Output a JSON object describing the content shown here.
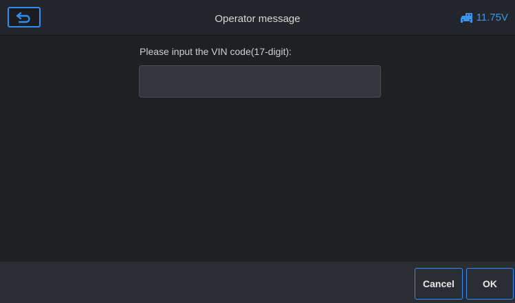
{
  "header": {
    "title": "Operator message",
    "battery_voltage": "11.75V"
  },
  "main": {
    "prompt": "Please input the VIN code(17-digit):",
    "vin_value": "",
    "vin_placeholder": ""
  },
  "footer": {
    "cancel_label": "Cancel",
    "ok_label": "OK"
  },
  "icons": {
    "back": "back-arrow-icon",
    "battery": "car-battery-icon"
  },
  "colors": {
    "accent": "#2f8ff5",
    "background": "#1e2024",
    "header": "#23262b",
    "footer": "#2a2d33",
    "input": "#33373d"
  }
}
